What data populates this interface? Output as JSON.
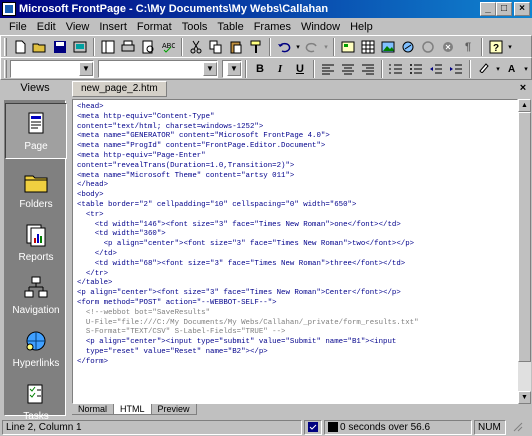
{
  "window": {
    "title": "Microsoft FrontPage - C:\\My Documents\\My Webs\\Callahan"
  },
  "menu": [
    "File",
    "Edit",
    "View",
    "Insert",
    "Format",
    "Tools",
    "Table",
    "Frames",
    "Window",
    "Help"
  ],
  "toolbar2": {
    "bold_label": "B",
    "italic_label": "I",
    "underline_label": "U"
  },
  "views": {
    "header": "Views",
    "items": [
      {
        "label": "Page",
        "icon": "page-view-icon",
        "active": true
      },
      {
        "label": "Folders",
        "icon": "folders-view-icon"
      },
      {
        "label": "Reports",
        "icon": "reports-view-icon"
      },
      {
        "label": "Navigation",
        "icon": "navigation-view-icon"
      },
      {
        "label": "Hyperlinks",
        "icon": "hyperlinks-view-icon"
      },
      {
        "label": "Tasks",
        "icon": "tasks-view-icon"
      }
    ]
  },
  "document": {
    "tab_label": "new_page_2.htm",
    "code_lines": [
      "<head>",
      "<meta http-equiv=\"Content-Type\"",
      "content=\"text/html; charset=windows-1252\">",
      "<meta name=\"GENERATOR\" content=\"Microsoft FrontPage 4.0\">",
      "<meta name=\"ProgId\" content=\"FrontPage.Editor.Document\">",
      "<meta http-equiv=\"Page-Enter\"",
      "content=\"revealTrans(Duration=1.0,Transition=2)\">",
      "<meta name=\"Microsoft Theme\" content=\"artsy 011\">",
      "</head>",
      "<body>",
      "<table border=\"2\" cellpadding=\"10\" cellspacing=\"0\" width=\"650\">",
      "  <tr>",
      "    <td width=\"146\"><font size=\"3\" face=\"Times New Roman\">one</font></td>",
      "    <td width=\"360\">",
      "      <p align=\"center\"><font size=\"3\" face=\"Times New Roman\">two</font></p>",
      "    </td>",
      "    <td width=\"68\"><font size=\"3\" face=\"Times New Roman\">three</font></td>",
      "  </tr>",
      "</table>",
      "<p align=\"center\"><font size=\"3\" face=\"Times New Roman\">Center</font></p>",
      "<form method=\"POST\" action=\"--WEBBOT-SELF--\">",
      "  <!--webbot bot=\"SaveResults\"",
      "  U-File=\"file:///C:/My Documents/My Webs/Callahan/_private/form_results.txt\"",
      "  S-Format=\"TEXT/CSV\" S-Label-Fields=\"TRUE\" -->",
      "  <p align=\"center\"><input type=\"submit\" value=\"Submit\" name=\"B1\"><input",
      "  type=\"reset\" value=\"Reset\" name=\"B2\"></p>",
      "</form>"
    ]
  },
  "bottom_tabs": [
    "Normal",
    "HTML",
    "Preview"
  ],
  "status": {
    "position": "Line 2, Column 1",
    "download_time": "0 seconds over 56.6",
    "num": "NUM"
  }
}
